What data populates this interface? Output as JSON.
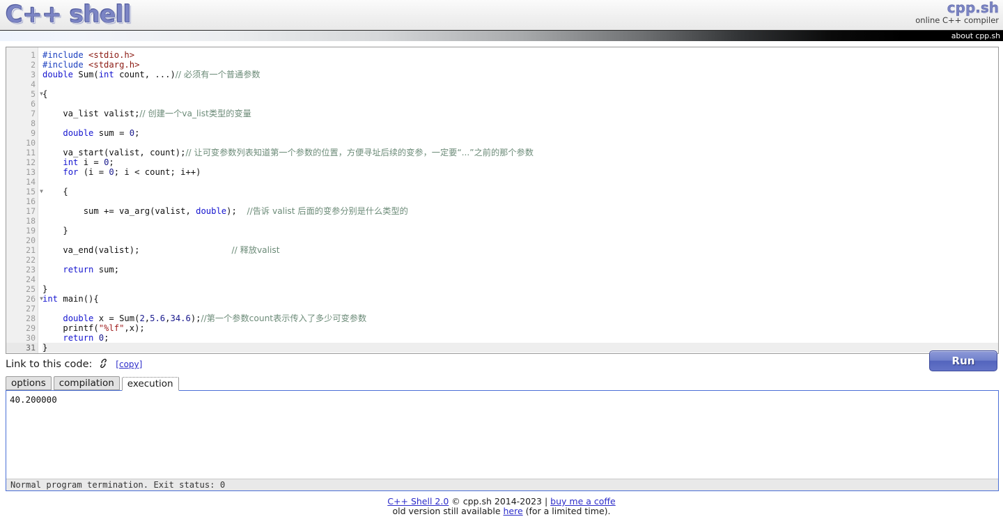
{
  "header": {
    "logo_text": "C++ shell",
    "brand_name": "cpp.sh",
    "brand_sub": "online C++ compiler",
    "about_link": "about cpp.sh"
  },
  "editor": {
    "total_lines": 31,
    "active_line": 31,
    "fold_lines": [
      5,
      15,
      26
    ],
    "lines": [
      {
        "n": 1,
        "segments": [
          {
            "t": "#include ",
            "c": "pre"
          },
          {
            "t": "<stdio.h>",
            "c": "inc"
          }
        ]
      },
      {
        "n": 2,
        "segments": [
          {
            "t": "#include ",
            "c": "pre"
          },
          {
            "t": "<stdarg.h>",
            "c": "inc"
          }
        ]
      },
      {
        "n": 3,
        "segments": [
          {
            "t": "double",
            "c": "kw"
          },
          {
            "t": " Sum(",
            "c": "plain"
          },
          {
            "t": "int",
            "c": "kw"
          },
          {
            "t": " count, ...)",
            "c": "plain"
          },
          {
            "t": "// 必须有一个普通参数",
            "c": "cmt-cn"
          }
        ]
      },
      {
        "n": 4,
        "segments": []
      },
      {
        "n": 5,
        "segments": [
          {
            "t": "{",
            "c": "plain"
          }
        ]
      },
      {
        "n": 6,
        "segments": []
      },
      {
        "n": 7,
        "segments": [
          {
            "t": "    va_list valist;",
            "c": "plain"
          },
          {
            "t": "// 创建一个va_list类型的变量",
            "c": "cmt-cn"
          }
        ]
      },
      {
        "n": 8,
        "segments": []
      },
      {
        "n": 9,
        "segments": [
          {
            "t": "    ",
            "c": "plain"
          },
          {
            "t": "double",
            "c": "kw"
          },
          {
            "t": " sum = ",
            "c": "plain"
          },
          {
            "t": "0",
            "c": "num"
          },
          {
            "t": ";",
            "c": "plain"
          }
        ]
      },
      {
        "n": 10,
        "segments": []
      },
      {
        "n": 11,
        "segments": [
          {
            "t": "    va_start(valist, count);",
            "c": "plain"
          },
          {
            "t": "// 让可变参数列表知道第一个参数的位置，方便寻址后续的变参，一定要“...”之前的那个参数",
            "c": "cmt-cn"
          }
        ]
      },
      {
        "n": 12,
        "segments": [
          {
            "t": "    ",
            "c": "plain"
          },
          {
            "t": "int",
            "c": "kw"
          },
          {
            "t": " i = ",
            "c": "plain"
          },
          {
            "t": "0",
            "c": "num"
          },
          {
            "t": ";",
            "c": "plain"
          }
        ]
      },
      {
        "n": 13,
        "segments": [
          {
            "t": "    ",
            "c": "plain"
          },
          {
            "t": "for",
            "c": "kw"
          },
          {
            "t": " (i = ",
            "c": "plain"
          },
          {
            "t": "0",
            "c": "num"
          },
          {
            "t": "; i < count; i++)",
            "c": "plain"
          }
        ]
      },
      {
        "n": 14,
        "segments": []
      },
      {
        "n": 15,
        "segments": [
          {
            "t": "    {",
            "c": "plain"
          }
        ]
      },
      {
        "n": 16,
        "segments": []
      },
      {
        "n": 17,
        "segments": [
          {
            "t": "        sum += va_arg(valist, ",
            "c": "plain"
          },
          {
            "t": "double",
            "c": "kw"
          },
          {
            "t": ");  ",
            "c": "plain"
          },
          {
            "t": "//告诉 valist 后面的变参分别是什么类型的",
            "c": "cmt-cn"
          }
        ]
      },
      {
        "n": 18,
        "segments": []
      },
      {
        "n": 19,
        "segments": [
          {
            "t": "    }",
            "c": "plain"
          }
        ]
      },
      {
        "n": 20,
        "segments": []
      },
      {
        "n": 21,
        "segments": [
          {
            "t": "    va_end(valist);                  ",
            "c": "plain"
          },
          {
            "t": "// 释放valist",
            "c": "cmt-cn"
          }
        ]
      },
      {
        "n": 22,
        "segments": []
      },
      {
        "n": 23,
        "segments": [
          {
            "t": "    ",
            "c": "plain"
          },
          {
            "t": "return",
            "c": "kw"
          },
          {
            "t": " sum;",
            "c": "plain"
          }
        ]
      },
      {
        "n": 24,
        "segments": []
      },
      {
        "n": 25,
        "segments": [
          {
            "t": "}",
            "c": "plain"
          }
        ]
      },
      {
        "n": 26,
        "segments": [
          {
            "t": "int",
            "c": "kw"
          },
          {
            "t": " main()",
            "c": "plain"
          },
          {
            "t": "{",
            "c": "plain"
          }
        ]
      },
      {
        "n": 27,
        "segments": []
      },
      {
        "n": 28,
        "segments": [
          {
            "t": "    ",
            "c": "plain"
          },
          {
            "t": "double",
            "c": "kw"
          },
          {
            "t": " x = Sum(",
            "c": "plain"
          },
          {
            "t": "2",
            "c": "num"
          },
          {
            "t": ",",
            "c": "plain"
          },
          {
            "t": "5.6",
            "c": "num"
          },
          {
            "t": ",",
            "c": "plain"
          },
          {
            "t": "34.6",
            "c": "num"
          },
          {
            "t": ");",
            "c": "plain"
          },
          {
            "t": "//第一个参数count表示传入了多少可变参数",
            "c": "cmt-cn"
          }
        ]
      },
      {
        "n": 29,
        "segments": [
          {
            "t": "    printf(",
            "c": "plain"
          },
          {
            "t": "\"%lf\"",
            "c": "str"
          },
          {
            "t": ",x);",
            "c": "plain"
          }
        ]
      },
      {
        "n": 30,
        "segments": [
          {
            "t": "    ",
            "c": "plain"
          },
          {
            "t": "return",
            "c": "kw"
          },
          {
            "t": " ",
            "c": "plain"
          },
          {
            "t": "0",
            "c": "num"
          },
          {
            "t": ";",
            "c": "plain"
          }
        ]
      },
      {
        "n": 31,
        "segments": [
          {
            "t": "}",
            "c": "plain"
          }
        ]
      }
    ]
  },
  "linkrow": {
    "label": "Link to this code:",
    "copy_label": "[copy]",
    "chain_icon": "chain-link-icon",
    "run_label": "Run"
  },
  "tabs": [
    {
      "id": "options",
      "label": "options",
      "active": false
    },
    {
      "id": "compilation",
      "label": "compilation",
      "active": false
    },
    {
      "id": "execution",
      "label": "execution",
      "active": true
    }
  ],
  "output": {
    "text": "40.200000",
    "status": "Normal program termination. Exit status: 0"
  },
  "footer": {
    "line1_link1": "C++ Shell 2.0",
    "line1_mid": " © cpp.sh 2014-2023 | ",
    "line1_link2": "buy me a coffe",
    "line2_pre": "old version still available ",
    "line2_link": "here",
    "line2_post": " (for a limited time)."
  },
  "colors": {
    "logo": "#7b84c4",
    "accent_link": "#2b2bc9",
    "run_button": "#6474c7",
    "output_border": "#4a6fd6",
    "comment": "#6c8b78",
    "keyword": "#1414cf",
    "string": "#a01d1d",
    "number": "#17188c",
    "include_path": "#8b1a12"
  }
}
